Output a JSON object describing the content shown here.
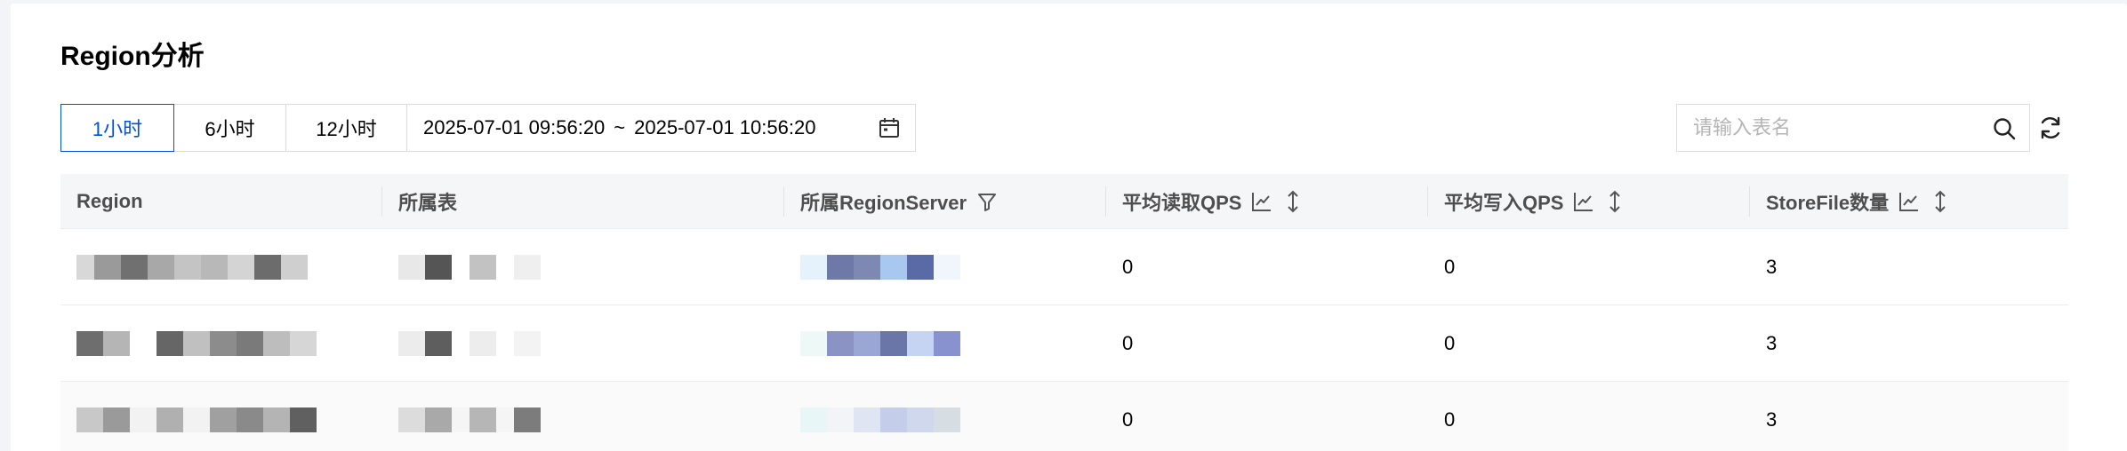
{
  "page_title": "Region分析",
  "time_tabs": [
    {
      "label": "1小时",
      "active": true
    },
    {
      "label": "6小时",
      "active": false
    },
    {
      "label": "12小时",
      "active": false
    }
  ],
  "date_range": {
    "start": "2025-07-01 09:56:20",
    "separator": "~",
    "end": "2025-07-01 10:56:20"
  },
  "search": {
    "placeholder": "请输入表名",
    "value": ""
  },
  "icons": {
    "calendar": "calendar-icon",
    "search": "search-icon",
    "refresh": "refresh-icon",
    "filter": "filter-icon",
    "trend": "trend-chart-icon",
    "sort": "sort-icon"
  },
  "colors": {
    "accent": "#0052d9",
    "header_bg": "#f5f6f8"
  },
  "table": {
    "columns": [
      "Region",
      "所属表",
      "所属RegionServer",
      "平均读取QPS",
      "平均写入QPS",
      "StoreFile数量"
    ],
    "rows": [
      {
        "region": "[redacted]",
        "table": "[redacted]",
        "server": "[redacted]",
        "read_qps": "0",
        "write_qps": "0",
        "storefile_count": "3"
      },
      {
        "region": "[redacted]",
        "table": "[redacted]",
        "server": "[redacted]",
        "read_qps": "0",
        "write_qps": "0",
        "storefile_count": "3"
      },
      {
        "region": "[redacted]",
        "table": "[redacted]",
        "server": "[redacted]",
        "read_qps": "0",
        "write_qps": "0",
        "storefile_count": "3"
      }
    ]
  }
}
